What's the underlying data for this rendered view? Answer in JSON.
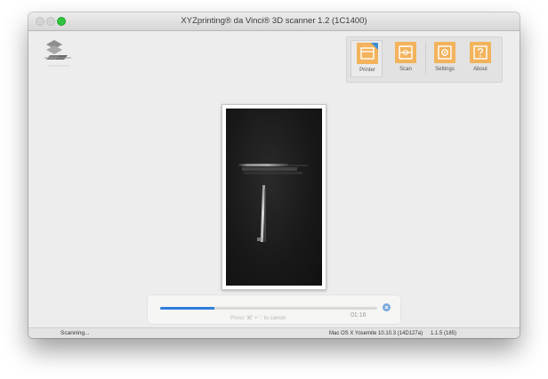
{
  "window": {
    "title": "XYZprinting® da Vinci® 3D scanner 1.2 (1C1400)"
  },
  "toolbar": {
    "items": [
      {
        "label": "Printer",
        "icon": "printer-icon",
        "active": true
      },
      {
        "label": "Scan",
        "icon": "scan-icon",
        "active": false
      },
      {
        "label": "Settings",
        "icon": "settings-icon",
        "active": false
      },
      {
        "label": "About",
        "icon": "about-icon",
        "active": false
      }
    ]
  },
  "progress": {
    "fraction": 0.25,
    "hint": "Press '⌘' + '.' to cancel",
    "time": "01:16",
    "cancel_icon": "cancel-icon"
  },
  "status": {
    "left": "Scanning...",
    "os": "Mac OS X Yosemite 10.10.3 (14D127a)",
    "version": "1.1.5 (185)"
  },
  "colors": {
    "accent": "#f2b35c",
    "progress": "#2f7ddc",
    "zoom_button": "#2fc43f"
  }
}
